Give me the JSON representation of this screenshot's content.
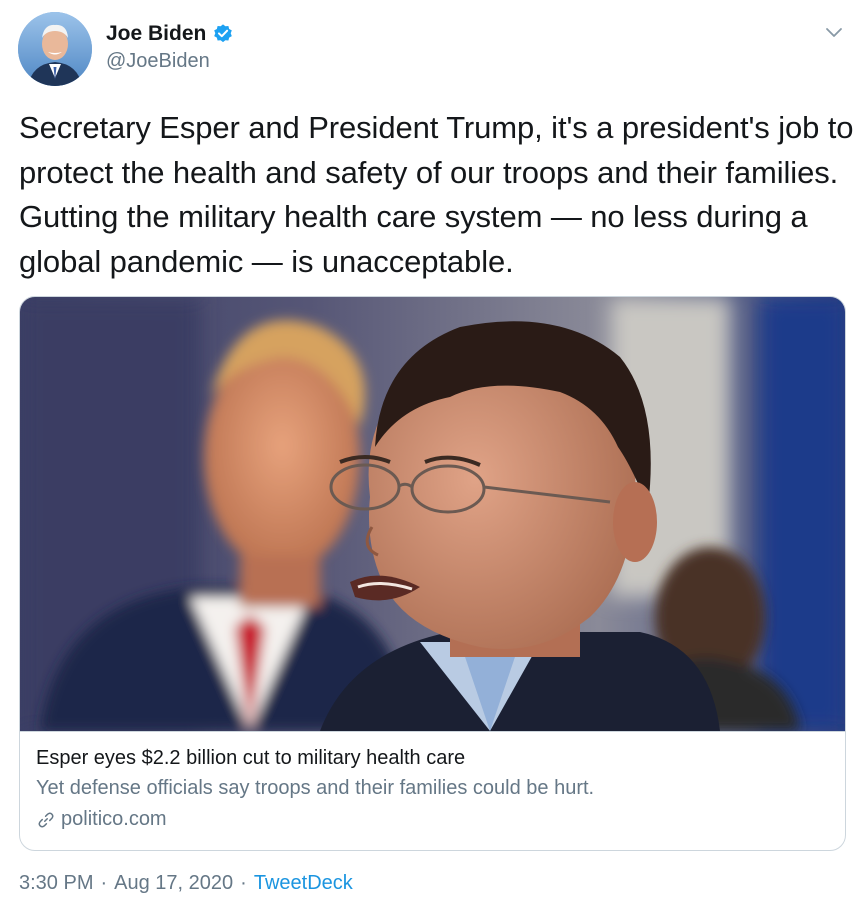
{
  "author": {
    "name": "Joe Biden",
    "handle": "@JoeBiden",
    "verified": true,
    "avatar_icon": "profile-photo",
    "verified_icon": "verified-badge-icon"
  },
  "tweet": {
    "text": "Secretary Esper and President Trump, it's a president's job to protect the health and safety of our troops and their families. Gutting the military health care system — no less during a global pandemic — is unacceptable."
  },
  "card": {
    "title": "Esper eyes $2.2 billion cut to military health care",
    "description": "Yet defense officials say troops and their families could be hurt.",
    "domain": "politico.com",
    "domain_icon": "link-icon"
  },
  "meta": {
    "time": "3:30 PM",
    "separator": "·",
    "date": "Aug 17, 2020",
    "source": "TweetDeck"
  },
  "colors": {
    "accent": "#1b95e0",
    "verified": "#1da1f2",
    "secondary_text": "#657786",
    "primary_text": "#14171a",
    "border": "#cdd6dd"
  }
}
